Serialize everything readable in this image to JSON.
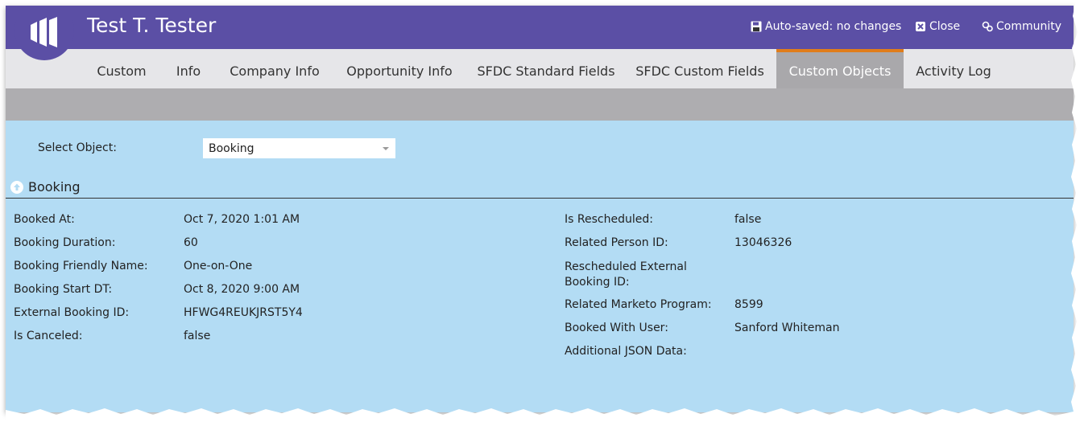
{
  "header": {
    "title": "Test T. Tester",
    "autosave_label": "Auto-saved: no changes",
    "close_label": "Close",
    "community_label": "Community"
  },
  "tabs": [
    {
      "label": "Custom"
    },
    {
      "label": "Info"
    },
    {
      "label": "Company Info"
    },
    {
      "label": "Opportunity Info"
    },
    {
      "label": "SFDC Standard Fields"
    },
    {
      "label": "SFDC Custom Fields"
    },
    {
      "label": "Custom Objects",
      "active": true
    },
    {
      "label": "Activity Log"
    }
  ],
  "select_object": {
    "label": "Select Object:",
    "value": "Booking"
  },
  "section": {
    "title": "Booking",
    "left_fields": [
      {
        "label": "Booked At:",
        "value": "Oct 7, 2020 1:01 AM"
      },
      {
        "label": "Booking Duration:",
        "value": "60"
      },
      {
        "label": "Booking Friendly Name:",
        "value": "One-on-One"
      },
      {
        "label": "Booking Start DT:",
        "value": "Oct 8, 2020 9:00 AM"
      },
      {
        "label": "External Booking ID:",
        "value": "HFWG4REUKJRST5Y4"
      },
      {
        "label": "Is Canceled:",
        "value": "false"
      }
    ],
    "right_fields": [
      {
        "label": "Is Rescheduled:",
        "value": "false"
      },
      {
        "label": "Related Person ID:",
        "value": "13046326"
      },
      {
        "label": "Rescheduled External Booking ID:",
        "value": ""
      },
      {
        "label": "Related Marketo Program:",
        "value": "8599"
      },
      {
        "label": "Booked With User:",
        "value": "Sanford Whiteman"
      },
      {
        "label": "Additional JSON Data:",
        "value": ""
      }
    ]
  },
  "colors": {
    "header_bg": "#5b4fa5",
    "tab_active_accent": "#e07d1b",
    "content_bg": "#b3dcf4"
  }
}
